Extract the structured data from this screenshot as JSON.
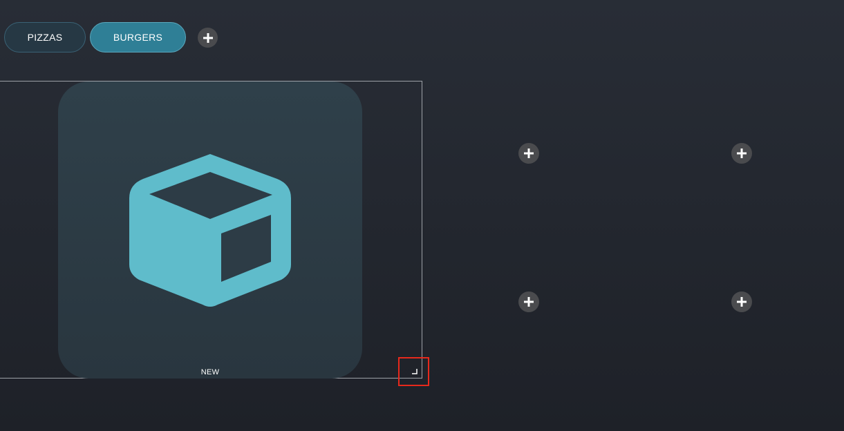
{
  "tabs": [
    {
      "label": "PIZZAS",
      "active": false
    },
    {
      "label": "BURGERS",
      "active": true
    }
  ],
  "tile": {
    "label": "NEW",
    "icon": "cube-icon",
    "icon_color": "#5fbccb"
  },
  "colors": {
    "active_tab": "#2f7f96",
    "inactive_tab": "#263844",
    "selection_highlight": "#e8291c",
    "add_button": "#4a4b4e"
  },
  "empty_slots": 4
}
